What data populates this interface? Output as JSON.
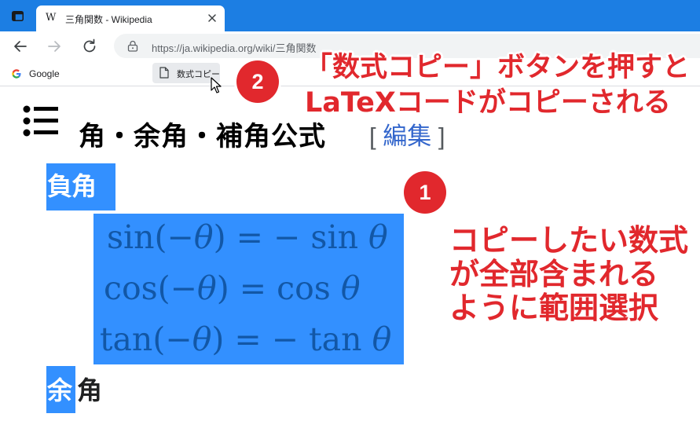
{
  "browser": {
    "tab_favicon": "W",
    "tab_title": "三角関数 - Wikipedia",
    "address_url": "https://ja.wikipedia.org/wiki/三角関数",
    "bookmarks": {
      "google_label": "Google",
      "math_copy_label": "数式コピー"
    },
    "icons": [
      "window-icon",
      "close-icon",
      "back-icon",
      "forward-icon",
      "reload-icon",
      "lock-icon",
      "google-icon",
      "page-icon",
      "mouse-cursor-icon"
    ]
  },
  "page": {
    "section_heading": "角・余角・補角公式",
    "edit_open": "[",
    "edit_label": "編集",
    "edit_close": "]",
    "subsection_1": "負角",
    "math_lines": [
      {
        "left": "sin(−",
        "var": "θ",
        "right": ") = − sin",
        "var2": "θ"
      },
      {
        "left": "cos(−",
        "var": "θ",
        "right": ") = cos",
        "var2": "θ"
      },
      {
        "left": "tan(−",
        "var": "θ",
        "right": ") = − tan",
        "var2": "θ"
      }
    ],
    "subsection_2_highlighted": "余",
    "subsection_2_rest": "角"
  },
  "annotations": {
    "badge_1": "1",
    "badge_2": "2",
    "top_line_1": "「数式コピー」ボタンを押すと",
    "top_line_2": "LaTeXコードがコピーされる",
    "right_line_1": "コピーしたい数式",
    "right_line_2": "が全部含まれる",
    "right_line_3": "ように範囲選択"
  },
  "colors": {
    "tabstrip": "#1c7ee3",
    "selection": "#3390ff",
    "annotation_red": "#e1282d",
    "link": "#3366cc"
  }
}
